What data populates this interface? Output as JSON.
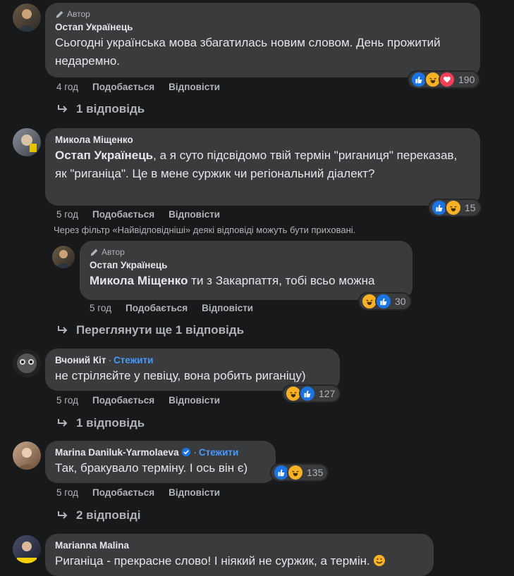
{
  "comments": [
    {
      "author_badge": "Автор",
      "author": "Остап Українець",
      "text": "Сьогодні українська мова збагатилась новим словом. День прожитий недаремно.",
      "time": "4 год",
      "like": "Подобається",
      "reply": "Відповісти",
      "reactions": [
        "like-icon",
        "haha-icon",
        "love-icon"
      ],
      "count": "190",
      "replies": "1 відповідь"
    },
    {
      "author": "Микола Міщенко",
      "mention": "Остап Українець",
      "text": ", а я суто підсвідомо твій термін \"риганиця\" переказав, як \"риганіца\". Це в мене суржик чи регіональний діалект?",
      "time": "5 год",
      "like": "Подобається",
      "reply": "Відповісти",
      "reactions": [
        "like-icon",
        "haha-icon"
      ],
      "count": "15",
      "filter_note": "Через фільтр «Найвідповідніші» деякі відповіді можуть бути приховані."
    },
    {
      "author_badge": "Автор",
      "author": "Остап Українець",
      "mention": "Микола Міщенко",
      "text": " ти з Закарпаття, тобі всьо можна",
      "time": "5 год",
      "like": "Подобається",
      "reply": "Відповісти",
      "reactions": [
        "haha-icon",
        "like-icon"
      ],
      "count": "30",
      "more_replies": "Переглянути ще 1 відповідь"
    },
    {
      "author": "Вчоний Кіт",
      "follow": "Стежити",
      "text": "не стріляєйте у певіцу, вона робить риганіцу)",
      "time": "5 год",
      "like": "Подобається",
      "reply": "Відповісти",
      "reactions": [
        "haha-icon",
        "like-icon"
      ],
      "count": "127",
      "replies": "1 відповідь"
    },
    {
      "author": "Marina Daniluk-Yarmolaeva",
      "follow": "Стежити",
      "text": "Так, бракувало терміну. І ось він є)",
      "time": "5 год",
      "like": "Подобається",
      "reply": "Відповісти",
      "reactions": [
        "like-icon",
        "haha-icon"
      ],
      "count": "135",
      "replies": "2 відповіді"
    },
    {
      "author": "Marianna Malina",
      "text": "Риганіца - прекрасне слово! І ніякий не суржик, а термін. "
    }
  ],
  "colors": {
    "background": "#18191a",
    "bubble": "#3a3b3c",
    "link": "#4599ff",
    "like": "#1b74e4",
    "haha": "#f7b125",
    "love": "#f33e58"
  }
}
